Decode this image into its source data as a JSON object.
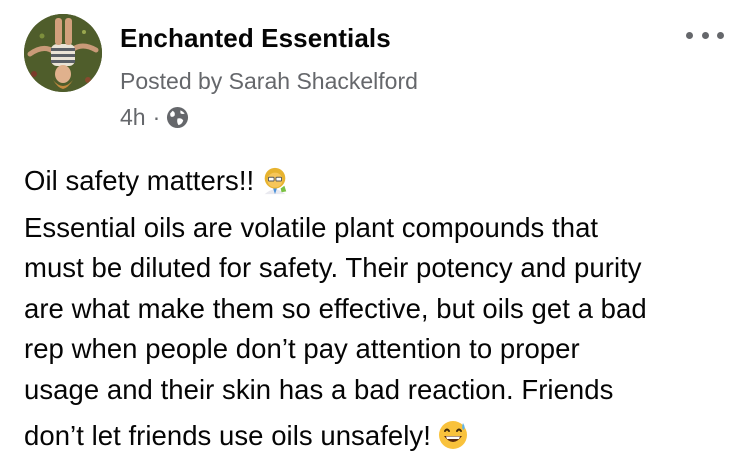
{
  "post": {
    "page_name": "Enchanted Essentials",
    "posted_by": "Posted by Sarah Shackelford",
    "timestamp": "4h",
    "separator": "·",
    "audience_icon": "globe-icon",
    "more_icon": "more-options-icon",
    "text_lines": [
      "Oil safety matters!!",
      "Essential oils are volatile plant compounds that",
      "must be diluted for safety. Their potency and purity",
      "are what make them so effective, but oils get a bad",
      "rep when people don’t pay attention to proper",
      "usage and their skin has a bad reaction. Friends",
      "don’t let friends use oils unsafely!"
    ],
    "emoji_first_line": "woman-scientist-emoji",
    "emoji_last_line": "grinning-sweat-emoji"
  },
  "colors": {
    "primary_text": "#050505",
    "secondary_text": "#65676b",
    "background": "#ffffff"
  }
}
